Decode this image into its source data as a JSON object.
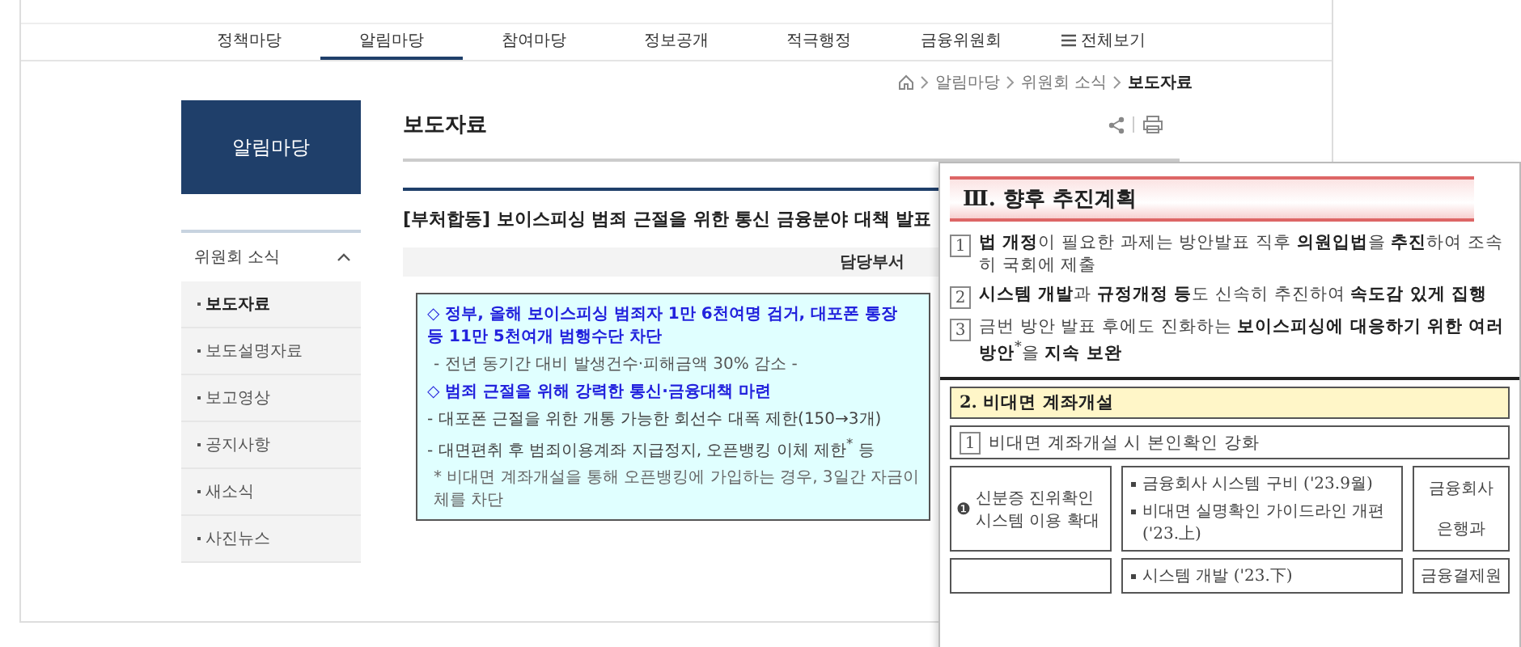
{
  "nav": {
    "items": [
      {
        "label": "정책마당",
        "selected": false,
        "kind": "menu"
      },
      {
        "label": "알림마당",
        "selected": true,
        "kind": "menu"
      },
      {
        "label": "참여마당",
        "selected": false,
        "kind": "menu"
      },
      {
        "label": "정보공개",
        "selected": false,
        "kind": "menu"
      },
      {
        "label": "적극행정",
        "selected": false,
        "kind": "menu"
      },
      {
        "label": "금융위원회",
        "selected": false,
        "kind": "menu"
      },
      {
        "label": "전체보기",
        "selected": false,
        "kind": "all"
      }
    ]
  },
  "breadcrumb": [
    "알림마당",
    "위원회 소식",
    "보도자료"
  ],
  "sidebar": {
    "title": "알림마당",
    "section": {
      "label": "위원회 소식",
      "expanded": true,
      "items": [
        {
          "label": "보도자료",
          "selected": true
        },
        {
          "label": "보도설명자료",
          "selected": false
        },
        {
          "label": "보고영상",
          "selected": false
        },
        {
          "label": "공지사항",
          "selected": false
        },
        {
          "label": "새소식",
          "selected": false
        },
        {
          "label": "사진뉴스",
          "selected": false
        }
      ]
    }
  },
  "main": {
    "title": "보도자료",
    "article_title": "[부처합동] 보이스피싱 범죄 근절을 위한 통신 금융분야 대책 발표",
    "department_label": "담당부서",
    "summary": [
      {
        "kind": "headline",
        "text": "◇ 정부, 올해 보이스피싱 범죄자 1만 6천여명 검거, 대포폰 통장 등 11만 5천여개 범행수단 차단"
      },
      {
        "kind": "sub",
        "text": "- 전년 동기간 대비 발생건수·피해금액 30% 감소 -"
      },
      {
        "kind": "headline",
        "text": "◇ 범죄 근절을 위해 강력한 통신·금융대책 마련"
      },
      {
        "kind": "item",
        "text": "- 대포폰 근절을 위한 개통 가능한 회선수 대폭 제한(150→3개)"
      },
      {
        "kind": "item",
        "text": "- 대면편취 후 범죄이용계좌 지급정지, 오픈뱅킹 이체 제한$^{*}$ 등"
      },
      {
        "kind": "note",
        "text": "* 비대면 계좌개설을 통해 오픈뱅킹에 가입하는 경우, 3일간 자금이체를 차단"
      }
    ]
  },
  "document": {
    "heading": "Ⅲ. 향후 추진계획",
    "plans": [
      {
        "number": "1",
        "text": "**법 개정**이 필요한 과제는 방안발표 직후 **의원입법**을 **추진**하여 조속히 국회에 제출"
      },
      {
        "number": "2",
        "text": "**시스템 개발**과 **규정개정 등**도 신속히 추진하여 **속도감 있게 집행**"
      },
      {
        "number": "3",
        "text": "금번 방안 발표 후에도 진화하는 **보이스피싱에 대응하기 위한 여러 방안**$^{*}$을 **지속 보완**"
      }
    ],
    "section": "2. 비대면 계좌개설",
    "subsection": {
      "number": "1",
      "text": "비대면 계좌개설 시 본인확인 강화"
    },
    "rows": [
      {
        "marker": "❶",
        "task": "신분증 진위확인 시스템 이용 확대",
        "actions": [
          "금융회사 시스템 구비 ('23.9월)",
          "비대면 실명확인 가이드라인 개편 ('23.上)"
        ],
        "owners": [
          "금융회사",
          "은행과"
        ]
      },
      {
        "actions": [
          "시스템 개발 ('23.下)"
        ],
        "owners": [
          "금융결제원"
        ]
      }
    ]
  }
}
